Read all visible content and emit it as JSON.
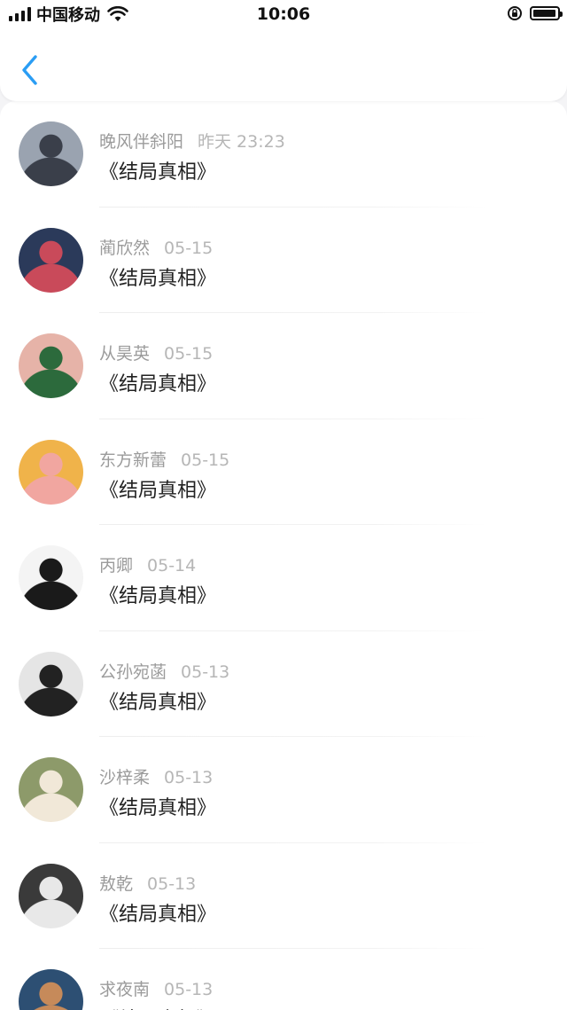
{
  "status_bar": {
    "carrier": "中国移动",
    "time": "10:06"
  },
  "nav": {
    "back_icon": "chevron-left-icon",
    "accent_color": "#2a9df4"
  },
  "messages": [
    {
      "name": "晚风伴斜阳",
      "time": "昨天 23:23",
      "title": "《结局真相》",
      "avatar": {
        "bg": "#9aa3b0",
        "fg": "#3a3f4a"
      }
    },
    {
      "name": "蔺欣然",
      "time": "05-15",
      "title": "《结局真相》",
      "avatar": {
        "bg": "#2b3a5a",
        "fg": "#c94a5a"
      }
    },
    {
      "name": "从昊英",
      "time": "05-15",
      "title": "《结局真相》",
      "avatar": {
        "bg": "#e6b3a8",
        "fg": "#2c6a3c"
      }
    },
    {
      "name": "东方新蕾",
      "time": "05-15",
      "title": "《结局真相》",
      "avatar": {
        "bg": "#f0b34a",
        "fg": "#f1a6a0"
      }
    },
    {
      "name": "丙卿",
      "time": "05-14",
      "title": "《结局真相》",
      "avatar": {
        "bg": "#f4f4f4",
        "fg": "#1a1a1a"
      }
    },
    {
      "name": "公孙宛菡",
      "time": "05-13",
      "title": "《结局真相》",
      "avatar": {
        "bg": "#e5e5e5",
        "fg": "#222222"
      }
    },
    {
      "name": "沙梓柔",
      "time": "05-13",
      "title": "《结局真相》",
      "avatar": {
        "bg": "#8d9a6a",
        "fg": "#f1e8d8"
      }
    },
    {
      "name": "敖乾",
      "time": "05-13",
      "title": "《结局真相》",
      "avatar": {
        "bg": "#3a3a3a",
        "fg": "#e8e8e8"
      }
    },
    {
      "name": "求夜南",
      "time": "05-13",
      "title": "《结局真相》",
      "avatar": {
        "bg": "#2d4f73",
        "fg": "#c68a5a"
      }
    }
  ]
}
